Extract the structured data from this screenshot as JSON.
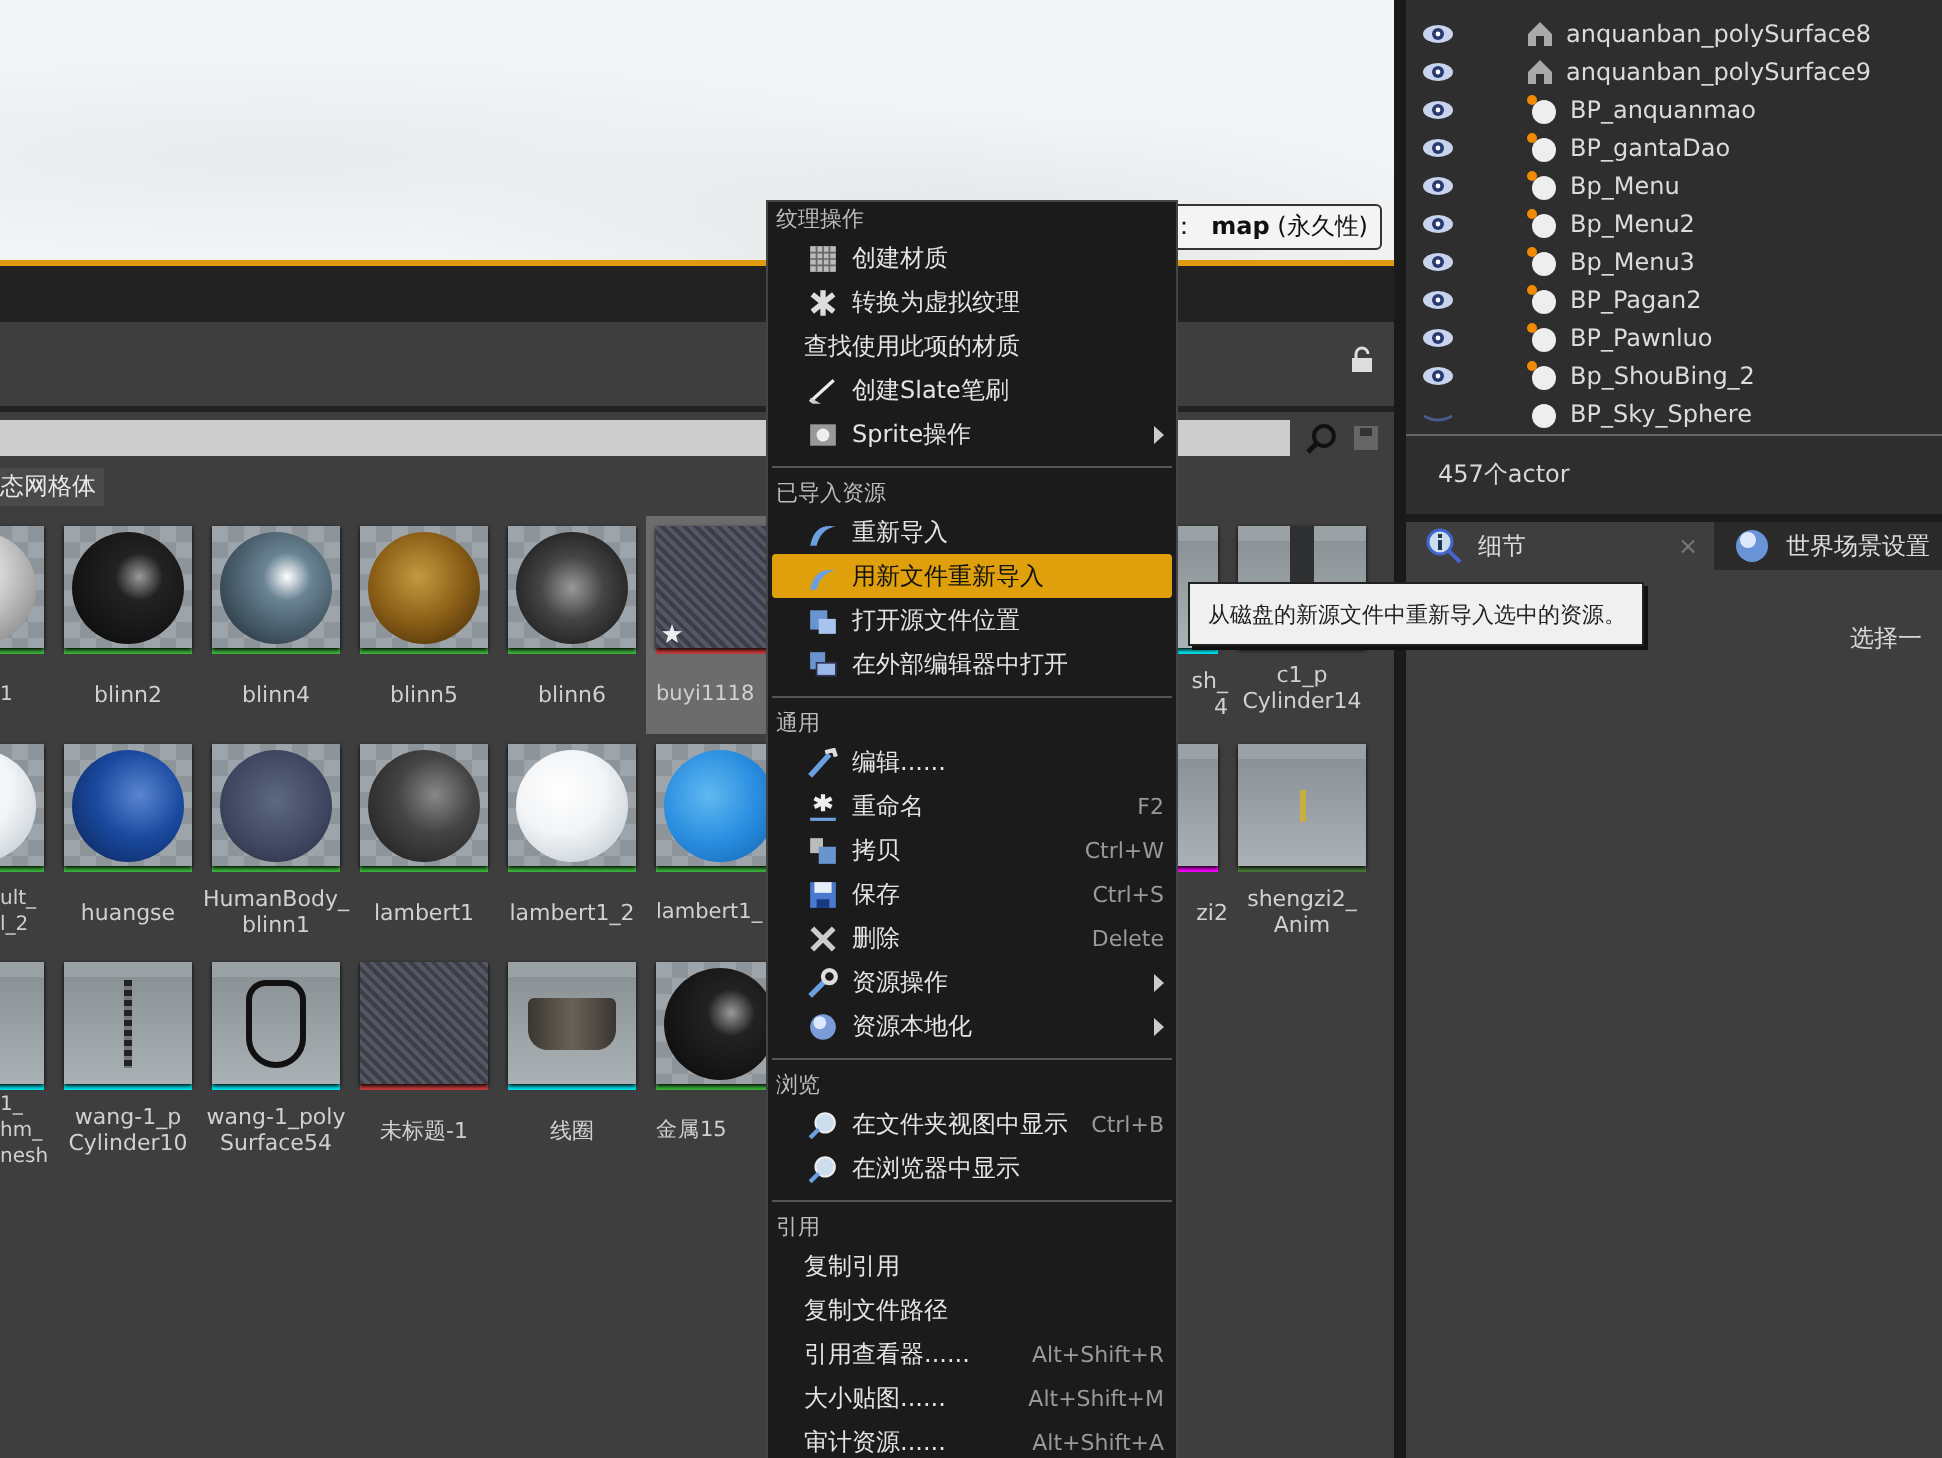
{
  "viewport": {
    "level_label": "：  **map** (永久性)"
  },
  "content_browser": {
    "filter_chip": "态网格体",
    "rows": [
      {
        "items": [
          {
            "label": "1",
            "kind": "chrome",
            "color": "#3cb43c",
            "selected": false
          },
          {
            "label": "blinn2",
            "kind": "black",
            "color": "#3cb43c",
            "selected": false,
            "modified": false
          },
          {
            "label": "blinn4",
            "kind": "steel",
            "color": "#3cb43c",
            "selected": false,
            "modified": false
          },
          {
            "label": "blinn5",
            "kind": "gold",
            "color": "#3cb43c",
            "selected": false,
            "modified": false
          },
          {
            "label": "blinn6",
            "kind": "pattern",
            "color": "#3cb43c",
            "selected": false,
            "modified": false
          },
          {
            "label": "buyi1118",
            "kind": "fabric",
            "color": "#c83c3c",
            "selected": true,
            "modified": true
          }
        ],
        "items_right": [
          {
            "label": "sh_\n4",
            "kind": "scene",
            "color": "#00e5ee",
            "selected": false
          },
          {
            "label": "c1_p\nCylinder14",
            "kind": "pillar",
            "selected": false
          }
        ]
      },
      {
        "items": [
          {
            "label": "ult_\nl_2",
            "kind": "white",
            "color": "#3cb43c",
            "selected": false
          },
          {
            "label": "huangse",
            "kind": "blue",
            "color": "#3cb43c",
            "selected": false,
            "modified": false
          },
          {
            "label": "HumanBody_\nblinn1",
            "kind": "navy",
            "color": "#3cb43c",
            "selected": false,
            "modified": false
          },
          {
            "label": "lambert1",
            "kind": "grey",
            "color": "#3cb43c",
            "selected": false,
            "modified": false
          },
          {
            "label": "lambert1_2",
            "kind": "white",
            "color": "#3cb43c",
            "selected": false,
            "modified": false
          },
          {
            "label": "lambert1_",
            "kind": "sky",
            "color": "#3cb43c",
            "selected": false,
            "modified": false
          }
        ],
        "items_right": [
          {
            "label": "zi2",
            "kind": "scene",
            "color": "#ff00ff",
            "selected": false
          },
          {
            "label": "shengzi2_\nAnim",
            "kind": "figure",
            "color": "#4a7a3a",
            "selected": false
          }
        ]
      },
      {
        "items": [
          {
            "label": "1_\nhm_\nnesh",
            "kind": "scene",
            "color": "#00e5ee",
            "selected": false
          },
          {
            "label": "wang-1_p\nCylinder10",
            "kind": "chain",
            "color": "#00e5ee",
            "selected": false,
            "modified": false
          },
          {
            "label": "wang-1_poly\nSurface54",
            "kind": "harness",
            "color": "#00e5ee",
            "selected": false,
            "modified": false
          },
          {
            "label": "未标题-1",
            "kind": "fabric",
            "color": "#c83c3c",
            "selected": false,
            "modified": false
          },
          {
            "label": "线圈",
            "kind": "ring",
            "color": "#00e5ee",
            "selected": false,
            "modified": false
          },
          {
            "label": "金属15",
            "kind": "black",
            "color": "#3cb43c",
            "selected": false,
            "modified": false
          }
        ],
        "items_right": []
      }
    ]
  },
  "outliner": {
    "rows": [
      {
        "name": "anquanban_polySurface8",
        "kind": "mesh",
        "visible": true
      },
      {
        "name": "anquanban_polySurface9",
        "kind": "mesh",
        "visible": true
      },
      {
        "name": "BP_anquanmao",
        "kind": "blueprint",
        "visible": true
      },
      {
        "name": "BP_gantaDao",
        "kind": "blueprint",
        "visible": true
      },
      {
        "name": "Bp_Menu",
        "kind": "blueprint",
        "visible": true
      },
      {
        "name": "Bp_Menu2",
        "kind": "blueprint",
        "visible": true
      },
      {
        "name": "Bp_Menu3",
        "kind": "blueprint",
        "visible": true
      },
      {
        "name": "BP_Pagan2",
        "kind": "blueprint",
        "visible": true
      },
      {
        "name": "BP_Pawnluo",
        "kind": "blueprint",
        "visible": true
      },
      {
        "name": "Bp_ShouBing_2",
        "kind": "blueprint",
        "visible": true
      },
      {
        "name": "BP_Sky_Sphere",
        "kind": "sphere",
        "visible": false
      }
    ],
    "status": "457个actor"
  },
  "details": {
    "tabs": [
      {
        "label": "细节",
        "kind": "info",
        "selected": true,
        "close": "×"
      },
      {
        "label": "世界场景设置",
        "kind": "globe",
        "selected": false
      }
    ],
    "hint": "选择一"
  },
  "context_menu": {
    "sections": [
      {
        "header": "纹理操作",
        "items": [
          {
            "label": "创建材质",
            "kind": "grid",
            "selected": false
          },
          {
            "label": "转换为虚拟纹理",
            "kind": "hatch",
            "selected": false
          },
          {
            "label": "查找使用此项的材质",
            "kind": "plain",
            "selected": false
          },
          {
            "label": "创建Slate笔刷",
            "kind": "brush",
            "selected": false
          },
          {
            "label": "Sprite操作",
            "kind": "image",
            "selected": false,
            "submenu": true
          }
        ]
      },
      {
        "header": "已导入资源",
        "items": [
          {
            "label": "重新导入",
            "kind": "reimport",
            "selected": false
          },
          {
            "label": "用新文件重新导入",
            "kind": "reimport",
            "selected": true
          },
          {
            "label": "打开源文件位置",
            "kind": "folder",
            "selected": false
          },
          {
            "label": "在外部编辑器中打开",
            "kind": "monitor",
            "selected": false
          }
        ]
      },
      {
        "header": "通用",
        "items": [
          {
            "label": "编辑......",
            "kind": "pencil",
            "selected": false
          },
          {
            "label": "重命名",
            "kind": "asterisk",
            "selected": false,
            "shortcut": "F2"
          },
          {
            "label": "拷贝",
            "kind": "copy",
            "selected": false,
            "shortcut": "Ctrl+W"
          },
          {
            "label": "保存",
            "kind": "disk",
            "selected": false,
            "shortcut": "Ctrl+S"
          },
          {
            "label": "删除",
            "kind": "cross",
            "selected": false,
            "shortcut": "Delete"
          },
          {
            "label": "资源操作",
            "kind": "wrench",
            "selected": false,
            "submenu": true
          },
          {
            "label": "资源本地化",
            "kind": "globe",
            "selected": false,
            "submenu": true
          }
        ]
      },
      {
        "header": "浏览",
        "items": [
          {
            "label": "在文件夹视图中显示",
            "kind": "magnifier",
            "selected": false,
            "shortcut": "Ctrl+B"
          },
          {
            "label": "在浏览器中显示",
            "kind": "magnifier",
            "selected": false
          }
        ]
      },
      {
        "header": "引用",
        "items": [
          {
            "label": "复制引用",
            "kind": "plain",
            "selected": false
          },
          {
            "label": "复制文件路径",
            "kind": "plain",
            "selected": false
          },
          {
            "label": "引用查看器......",
            "kind": "plain",
            "selected": false,
            "shortcut": "Alt+Shift+R"
          },
          {
            "label": "大小贴图......",
            "kind": "plain",
            "selected": false,
            "shortcut": "Alt+Shift+M"
          },
          {
            "label": "审计资源......",
            "kind": "plain",
            "selected": false,
            "shortcut": "Alt+Shift+A"
          }
        ]
      }
    ]
  },
  "tooltip": "从磁盘的新源文件中重新导入选中的资源。"
}
